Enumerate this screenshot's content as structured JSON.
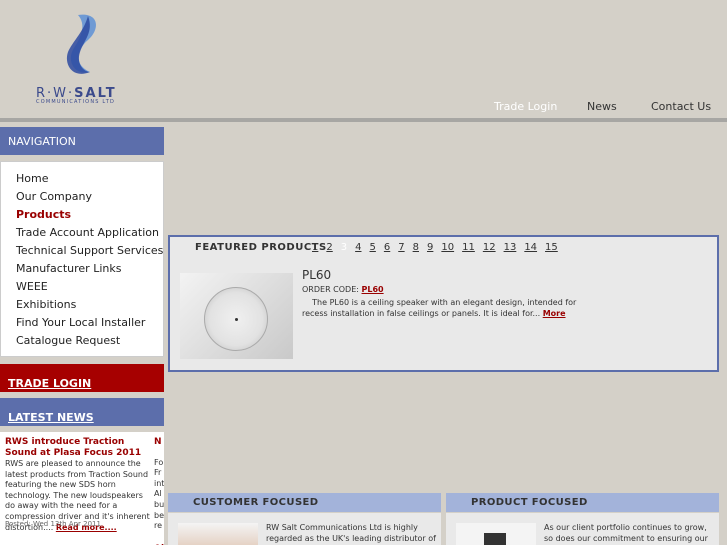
{
  "brand": {
    "name_prefix": "R·W·",
    "name_main": "SALT",
    "subtitle": "COMMUNICATIONS LTD",
    "accent_color": "#5c6eab"
  },
  "header_nav": [
    {
      "label": "Trade Login"
    },
    {
      "label": "News"
    },
    {
      "label": "Contact Us"
    }
  ],
  "navigation": {
    "heading": "NAVIGATION",
    "items": [
      {
        "label": "Home"
      },
      {
        "label": "Our Company"
      },
      {
        "label": "Products"
      },
      {
        "label": "Trade Account Application"
      },
      {
        "label": "Technical Support Services"
      },
      {
        "label": "Manufacturer Links"
      },
      {
        "label": "WEEE"
      },
      {
        "label": "Exhibitions"
      },
      {
        "label": "Find Your Local Installer"
      },
      {
        "label": "Catalogue Request"
      }
    ]
  },
  "trade_login": {
    "label": "TRADE LOGIN"
  },
  "latest_news": {
    "heading": "LATEST NEWS",
    "title": "RWS introduce Traction Sound at Plasa Focus 2011",
    "body": "RWS are pleased to announce the latest products from Traction Sound featuring the new SDS horn technology. The new loudspeakers do away with the need for a compression driver and it's inherent distortion....",
    "more": "Read more....",
    "date": "Posted: Wed 13th Apr 2011",
    "col2_title_fragment": "N",
    "col2_lines": [
      "Fo",
      "Fr",
      "int",
      "Al",
      "bu",
      "be",
      "re"
    ],
    "col2_bottom_fragment": "Ai"
  },
  "featured": {
    "label": "FEATURED PRODUCTS",
    "pages": [
      "1",
      "2",
      "3",
      "4",
      "5",
      "6",
      "7",
      "8",
      "9",
      "10",
      "11",
      "12",
      "13",
      "14",
      "15"
    ],
    "current_page": "3",
    "product": {
      "name": "PL60",
      "order_code_label": "ORDER CODE:",
      "order_code": "PL60",
      "description": "The PL60 is a ceiling speaker with an elegant design, intended for recess installation in false ceilings or panels. It is ideal for...",
      "more": "More"
    }
  },
  "panels": {
    "customer": {
      "heading": "CUSTOMER FOCUSED",
      "text": "RW Salt Communications Ltd is highly regarded as the UK's leading distributor of"
    },
    "product": {
      "heading": "PRODUCT FOCUSED",
      "text": "As our client portfolio continues to grow, so does our commitment to ensuring our"
    }
  }
}
